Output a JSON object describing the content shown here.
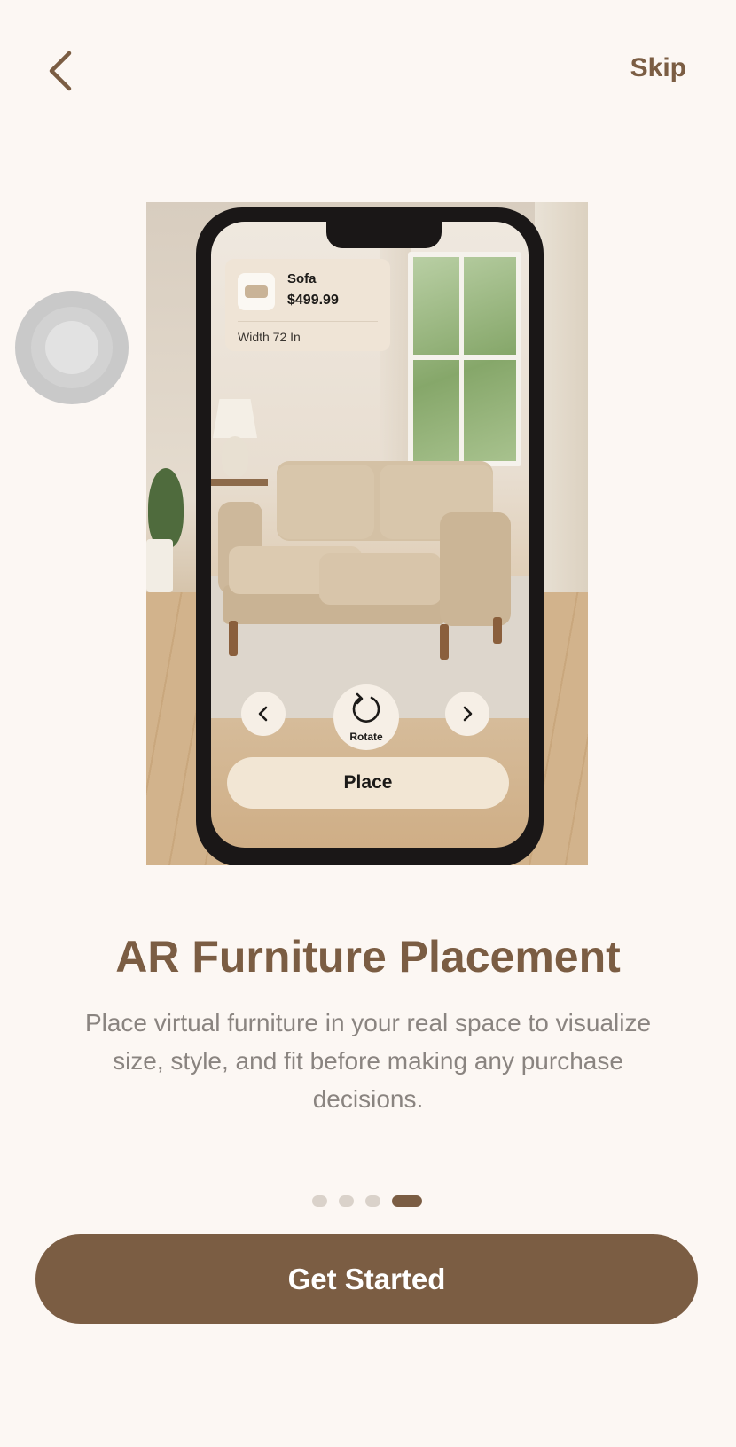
{
  "header": {
    "back_icon": "chevron-left-icon",
    "skip_label": "Skip"
  },
  "illustration": {
    "product_card": {
      "name": "Sofa",
      "price": "$499.99",
      "width_label": "Width 72 In"
    },
    "controls": {
      "prev_icon": "chevron-left-icon",
      "rotate_icon": "rotate-icon",
      "rotate_label": "Rotate",
      "next_icon": "chevron-right-icon",
      "place_label": "Place"
    }
  },
  "content": {
    "title": "AR Furniture Placement",
    "description": "Place virtual furniture in your real space to visualize size, style, and fit before making any purchase decisions."
  },
  "pagination": {
    "total": 4,
    "active_index": 3
  },
  "cta": {
    "label": "Get Started"
  },
  "colors": {
    "brand": "#7b5d43",
    "background": "#fcf7f3",
    "dot_inactive": "#dad2ca"
  }
}
